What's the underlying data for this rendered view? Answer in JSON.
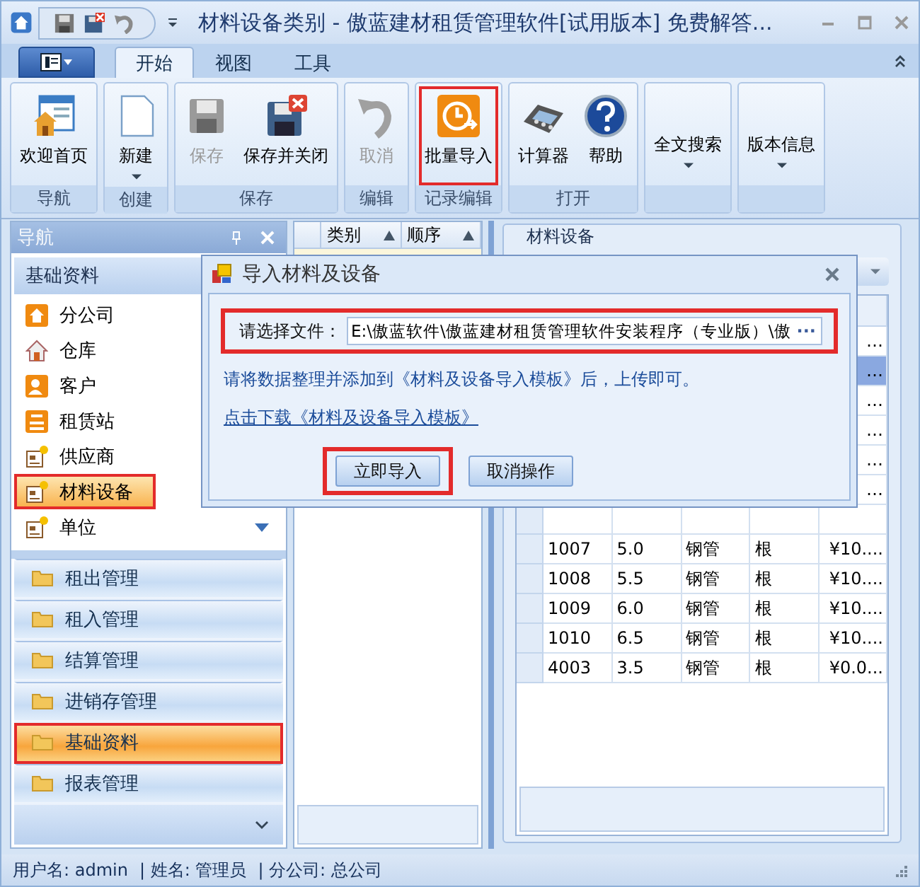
{
  "window": {
    "title": "材料设备类别 - 傲蓝建材租赁管理软件[试用版本] 免费解答..."
  },
  "ribbon_tabs": [
    {
      "label": "开始",
      "selected": true
    },
    {
      "label": "视图",
      "selected": false
    },
    {
      "label": "工具",
      "selected": false
    }
  ],
  "ribbon_groups": [
    {
      "label": "导航",
      "buttons": [
        {
          "label": "欢迎首页",
          "disabled": false,
          "dropdown": false,
          "highlighted": false
        }
      ]
    },
    {
      "label": "创建",
      "buttons": [
        {
          "label": "新建",
          "disabled": false,
          "dropdown": true,
          "highlighted": false
        }
      ]
    },
    {
      "label": "保存",
      "buttons": [
        {
          "label": "保存",
          "disabled": true,
          "dropdown": false,
          "highlighted": false
        },
        {
          "label": "保存并关闭",
          "disabled": false,
          "dropdown": false,
          "highlighted": false
        }
      ]
    },
    {
      "label": "编辑",
      "buttons": [
        {
          "label": "取消",
          "disabled": true,
          "dropdown": false,
          "highlighted": false
        }
      ]
    },
    {
      "label": "记录编辑",
      "buttons": [
        {
          "label": "批量导入",
          "disabled": false,
          "dropdown": false,
          "highlighted": true
        }
      ]
    },
    {
      "label": "打开",
      "buttons": [
        {
          "label": "计算器",
          "disabled": false,
          "dropdown": false,
          "highlighted": false
        },
        {
          "label": "帮助",
          "disabled": false,
          "dropdown": false,
          "highlighted": false
        }
      ]
    },
    {
      "buttons": [
        {
          "label": "全文搜索",
          "disabled": false,
          "dropdown": true,
          "highlighted": false
        }
      ]
    },
    {
      "buttons": [
        {
          "label": "版本信息",
          "disabled": false,
          "dropdown": true,
          "highlighted": false
        }
      ]
    }
  ],
  "navigation": {
    "title": "导航",
    "group_title": "基础资料",
    "items": [
      {
        "label": "分公司",
        "selected": false,
        "highlighted": false
      },
      {
        "label": "仓库",
        "selected": false,
        "highlighted": false
      },
      {
        "label": "客户",
        "selected": false,
        "highlighted": false
      },
      {
        "label": "租赁站",
        "selected": false,
        "highlighted": false
      },
      {
        "label": "供应商",
        "selected": false,
        "highlighted": false
      },
      {
        "label": "材料设备",
        "selected": true,
        "highlighted": true
      },
      {
        "label": "单位",
        "selected": false,
        "highlighted": false
      }
    ],
    "groups": [
      {
        "label": "租出管理",
        "selected": false,
        "highlighted": false
      },
      {
        "label": "租入管理",
        "selected": false,
        "highlighted": false
      },
      {
        "label": "结算管理",
        "selected": false,
        "highlighted": false
      },
      {
        "label": "进销存管理",
        "selected": false,
        "highlighted": false
      },
      {
        "label": "基础资料",
        "selected": true,
        "highlighted": true
      },
      {
        "label": "报表管理",
        "selected": false,
        "highlighted": false
      }
    ]
  },
  "category_table": {
    "columns": [
      "类别",
      "顺序"
    ]
  },
  "detail_panel": {
    "title": "材料设备",
    "rows": [
      {
        "cells": [
          "",
          "",
          "",
          "",
          "…"
        ],
        "selected": false
      },
      {
        "cells": [
          "",
          "",
          "",
          "",
          "…"
        ],
        "selected": true
      },
      {
        "cells": [
          "",
          "",
          "",
          "",
          "…"
        ],
        "selected": false
      },
      {
        "cells": [
          "",
          "",
          "",
          "",
          "…"
        ],
        "selected": false
      },
      {
        "cells": [
          "",
          "",
          "",
          "",
          "…"
        ],
        "selected": false
      },
      {
        "cells": [
          "",
          "",
          "",
          "",
          "…"
        ],
        "selected": false
      },
      {
        "cells": [
          "",
          "",
          "",
          "",
          ""
        ],
        "selected": false
      },
      {
        "cells": [
          "1007",
          "5.0",
          "钢管",
          "根",
          "¥10...."
        ],
        "selected": false
      },
      {
        "cells": [
          "1008",
          "5.5",
          "钢管",
          "根",
          "¥10...."
        ],
        "selected": false
      },
      {
        "cells": [
          "1009",
          "6.0",
          "钢管",
          "根",
          "¥10...."
        ],
        "selected": false
      },
      {
        "cells": [
          "1010",
          "6.5",
          "钢管",
          "根",
          "¥10...."
        ],
        "selected": false
      },
      {
        "cells": [
          "4003",
          "3.5",
          "钢管",
          "根",
          "¥0.0..."
        ],
        "selected": false
      }
    ]
  },
  "dialog": {
    "title": "导入材料及设备",
    "file_label": "请选择文件：",
    "file_value": "E:\\傲蓝软件\\傲蓝建材租赁管理软件安装程序（专业版）\\傲",
    "browse": "···",
    "file_highlighted": true,
    "hint": "请将数据整理并添加到《材料及设备导入模板》后，上传即可。",
    "link": "点击下载《材料及设备导入模板》",
    "buttons": [
      {
        "label": "立即导入",
        "highlighted": true
      },
      {
        "label": "取消操作",
        "highlighted": false
      }
    ]
  },
  "status_bar": [
    "用户名: admin",
    "| 姓名: 管理员",
    "| 分公司: 总公司"
  ]
}
